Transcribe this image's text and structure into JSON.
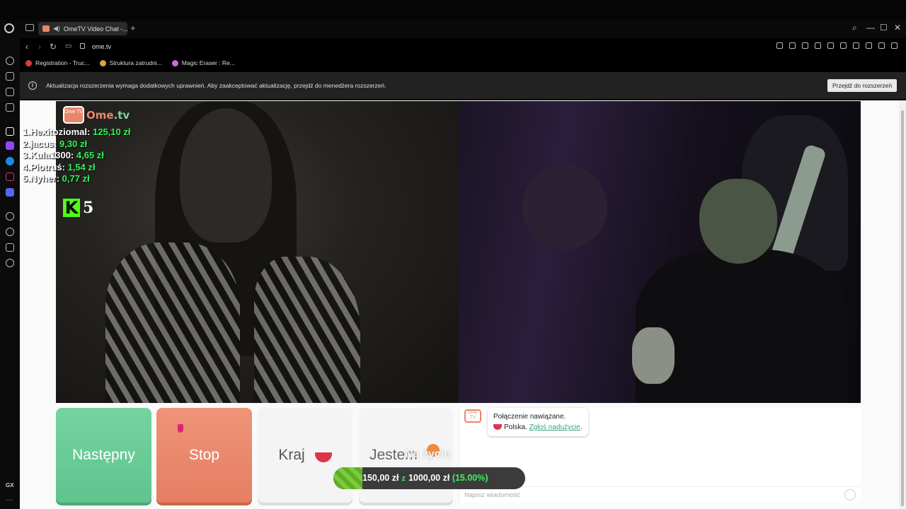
{
  "browser": {
    "tab_title": "OmeTV Video Chat -...",
    "url": "ome.tv",
    "new_tab": "+",
    "bookmarks": [
      {
        "label": "Registration - Truc...",
        "color": "#d8403a"
      },
      {
        "label": "Struktura zatrudni...",
        "color": "#e0a13a"
      },
      {
        "label": "Magic Eraser : Re...",
        "color": "#c66fd8"
      }
    ],
    "sidebar_label": "GX"
  },
  "notice": {
    "message": "Aktualizacja rozszerzenia wymaga dodatkowych uprawnień. Aby zaakceptować aktualizację, przejdź do menedżera rozszerzeń.",
    "button": "Przejdź do rozszerzeń"
  },
  "overlay": {
    "logo_box": "Ome TV",
    "logo_a": "Ome",
    "logo_b": ".tv",
    "leaderboard": [
      {
        "name": "1.Hexitoziomal:",
        "amount": "125,10 zł"
      },
      {
        "name": "2.jacus:",
        "amount": "9,30 zł"
      },
      {
        "name": "3.Kula1300:",
        "amount": "4,65 zł"
      },
      {
        "name": "4.Piotruś:",
        "amount": "1,54 zł"
      },
      {
        "name": "5.Nyher:",
        "amount": "0,77 zł"
      }
    ],
    "kick_letter": "K",
    "kick_count": "5",
    "na_zycie": "Na życie"
  },
  "controls": {
    "next": "Następny",
    "stop": "Stop",
    "country": "Kraj",
    "gender": "Jestem"
  },
  "chat": {
    "logo_text": "Ome TV",
    "status": "Połączenie nawiązane.",
    "country": "Polska.",
    "report_link": "Zgłoś nadużycie",
    "report_suffix": ".",
    "placeholder": "Napisz wiadomość"
  },
  "goal": {
    "current": "150,00 zł",
    "separator": "z",
    "target": "1000,00 zł",
    "percent_label": "(15.00%)",
    "progress": 0.15
  }
}
